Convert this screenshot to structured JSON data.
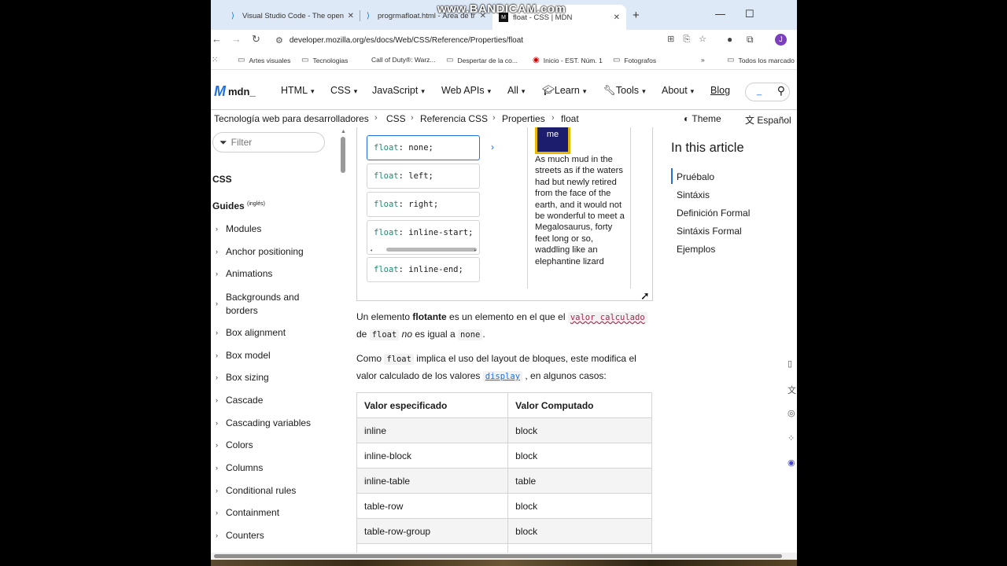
{
  "browser": {
    "tabs": [
      {
        "icon": "vscode-icon",
        "title": "Visual Studio Code - The open"
      },
      {
        "icon": "vscode-icon",
        "title": "progrmafloat.html - Área de tr"
      },
      {
        "icon": "mdn-icon",
        "title": "float - CSS | MDN"
      }
    ],
    "url": "developer.mozilla.org/es/docs/Web/CSS/Reference/Properties/float",
    "profile_initial": "J",
    "bookmarks": [
      "Artes visuales",
      "Tecnologias",
      "Call of Duty®: Warz...",
      "Despertar de la co...",
      "Inicio - EST. Núm. 1",
      "Fotografos"
    ],
    "bookmarks_all": "Todos los marcado",
    "watermark": "www.BANDICAM.com"
  },
  "header": {
    "logo_text": "mdn",
    "nav": [
      "HTML",
      "CSS",
      "JavaScript",
      "Web APIs",
      "All",
      "Learn",
      "Tools",
      "About"
    ],
    "blog": "Blog"
  },
  "breadcrumbs": {
    "items": [
      "Tecnología web para desarrolladores",
      "CSS",
      "Referencia CSS",
      "Properties",
      "float"
    ],
    "theme": "Theme",
    "language": "Español"
  },
  "sidebar": {
    "filter_placeholder": "Filter",
    "css_heading": "CSS",
    "guides_heading": "Guides",
    "guides_note": "(inglés)",
    "items": [
      "Modules",
      "Anchor positioning",
      "Animations",
      "Backgrounds and borders",
      "Box alignment",
      "Box model",
      "Box sizing",
      "Cascade",
      "Cascading variables",
      "Colors",
      "Columns",
      "Conditional rules",
      "Containment",
      "Counters"
    ]
  },
  "demo": {
    "options": [
      {
        "prop": "float",
        "value": "none;"
      },
      {
        "prop": "float",
        "value": "left;"
      },
      {
        "prop": "float",
        "value": "right;"
      },
      {
        "prop": "float",
        "value": "inline-start;"
      },
      {
        "prop": "float",
        "value": "inline-end;"
      }
    ],
    "box_label": "me",
    "preview_text": "As much mud in the streets as if the waters had but newly retired from the face of the earth, and it would not be wonderful to meet a Megalosaurus, forty feet long or so, waddling like an elephantine lizard"
  },
  "content": {
    "p1": {
      "t1": "Un elemento ",
      "bold": "flotante",
      "t2": " es un elemento en el que el ",
      "code1": "valor calculado",
      "t3": "de ",
      "code2": "float",
      "em": "no",
      "t4": " es igual a ",
      "code3": "none",
      "t5": "."
    },
    "p2": {
      "t1": "Como ",
      "code1": "float",
      "t2": " implica el uso del layout de bloques, este modifica el",
      "t3": "valor calculado de los valores ",
      "code2": "display",
      "t4": " , en algunos casos:"
    },
    "table": {
      "headers": [
        "Valor especificado",
        "Valor Computado"
      ],
      "rows": [
        [
          "inline",
          "block"
        ],
        [
          "inline-block",
          "block"
        ],
        [
          "inline-table",
          "table"
        ],
        [
          "table-row",
          "block"
        ],
        [
          "table-row-group",
          "block"
        ]
      ]
    }
  },
  "toc": {
    "title": "In this article",
    "items": [
      "Pruébalo",
      "Sintáxis",
      "Definición Formal",
      "Sintáxis Formal",
      "Ejemplos"
    ]
  }
}
